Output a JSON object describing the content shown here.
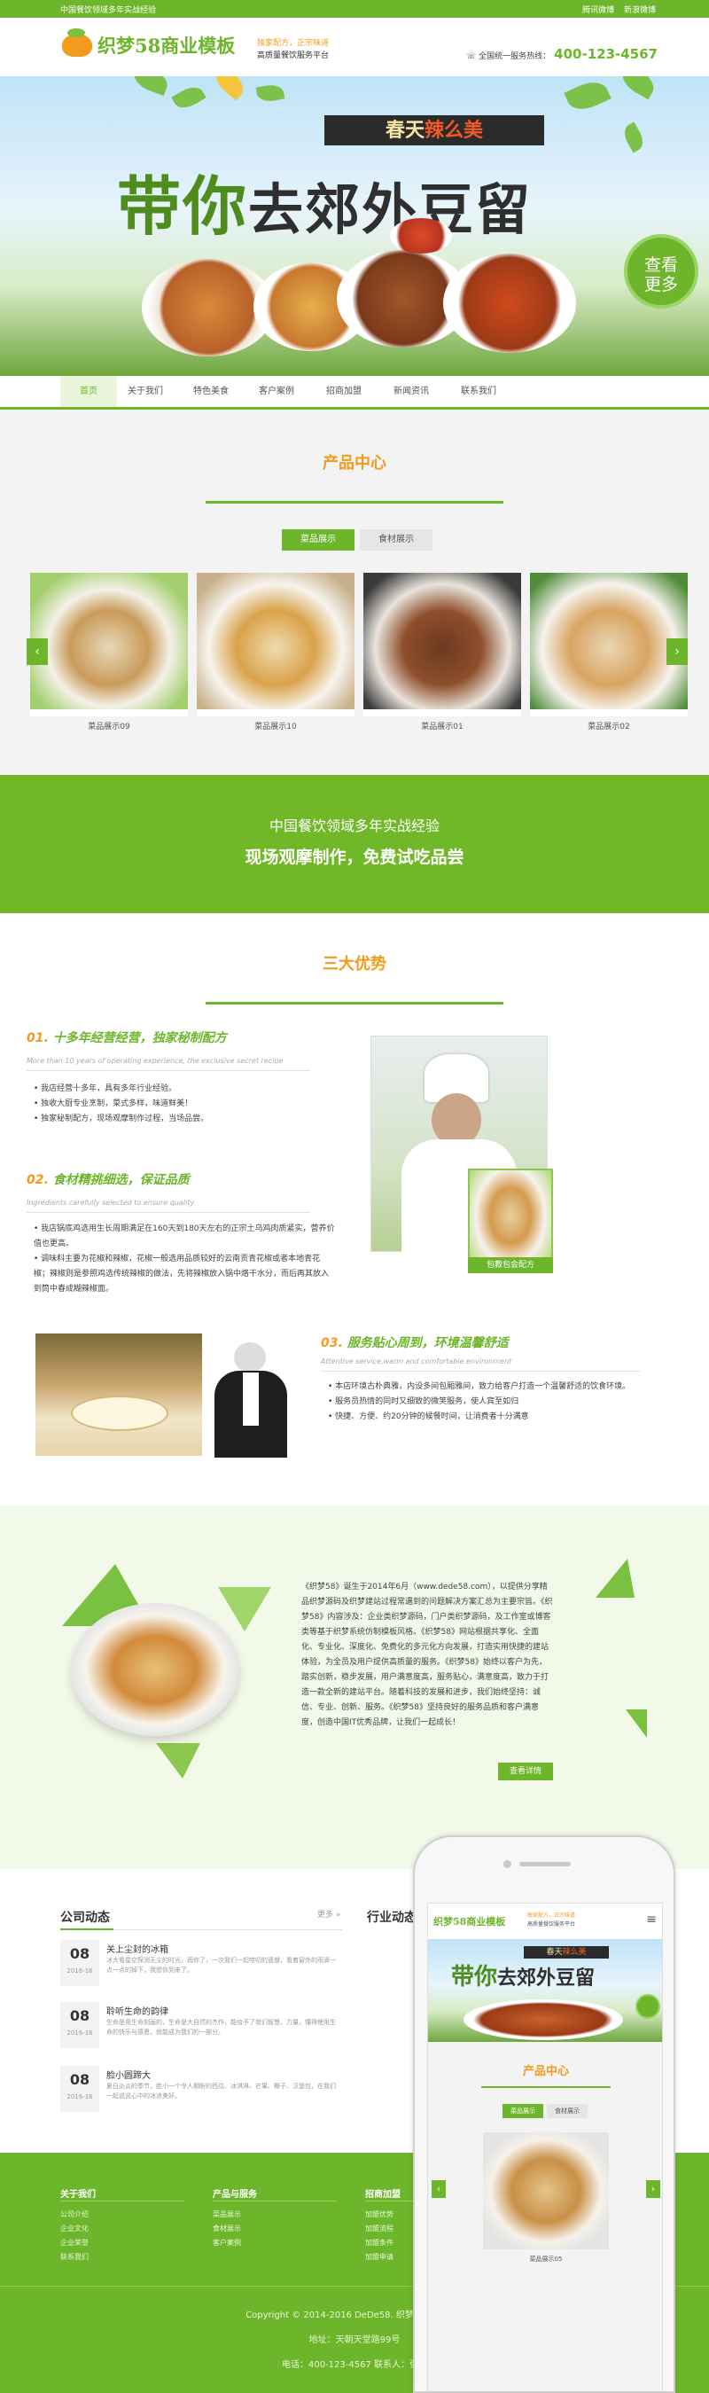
{
  "topbar": {
    "left": "中国餐饮领域多年实战经验",
    "links": [
      "腾讯微博",
      "新浪微博"
    ]
  },
  "header": {
    "logo": "织梦58商业模板",
    "slogan1": "独家配方，正宗味道",
    "slogan2": "高质量餐饮服务平台",
    "hotline_label": "全国统一服务热线：",
    "hotline_number": "400-123-4567"
  },
  "banner": {
    "ribbon_a": "春天",
    "ribbon_b": "辣么美",
    "title_a": "带你",
    "title_b": "去郊外豆留",
    "view_more": "查看更多"
  },
  "nav": [
    "首页",
    "关于我们",
    "特色美食",
    "客户案例",
    "招商加盟",
    "新闻资讯",
    "联系我们"
  ],
  "products": {
    "title": "产品中心",
    "tabs": [
      "菜品展示",
      "食材展示"
    ],
    "items": [
      "菜品展示09",
      "菜品展示10",
      "菜品展示01",
      "菜品展示02"
    ]
  },
  "band": {
    "line1": "中国餐饮领域多年实战经验",
    "line2": "现场观摩制作，免费试吃品尝"
  },
  "advantages": {
    "title": "三大优势",
    "a1": {
      "num": "01.",
      "title": "十多年经营经营，独家秘制配方",
      "sub": "More than 10 years of operating experience, the exclusive secret recipe",
      "list": [
        "我店经营十多年，具有多年行业经验。",
        "独收大厨专业烹制，菜式多样，味道鲜美！",
        "独家秘制配方，现场观摩制作过程，当场品尝。"
      ]
    },
    "a2": {
      "num": "02.",
      "title": "食材精挑细选，保证品质",
      "sub": "Ingredients carefully selected to ensure quality",
      "list": [
        "我店锅底鸡选用生长周期满足在160天到180天左右的正宗土乌鸡肉质紧实，营养价值也更高。",
        "调味料主要为花椒和辣椒，花椒一般选用品质较好的云南贡青花椒或者本地青花椒；辣椒则是参照鸡选传统辣椒的做法，先将辣椒放入锅中烙干水分，而后再其放入到筒中春成糊辣椒面。"
      ]
    },
    "a3": {
      "num": "03.",
      "title": "服务贴心周到，环境温馨舒适",
      "sub": "Attentive service,warm and comfortable environment",
      "list": [
        "本店环境古朴典雅，内设多间包厢雅间，致力给客户打造一个温馨舒适的饮食环境。",
        "服务员热情的同时又细致的微笑服务，使人宾至如归",
        "快捷、方便、约20分钟的候餐时间，让消费者十分满意"
      ]
    },
    "tag": "包教包会配方"
  },
  "about": {
    "text": "《织梦58》诞生于2014年6月（www.dede58.com），以提供分享精品织梦源码及织梦建站过程常遇到的问题解决方案汇总为主要宗旨。《织梦58》内容涉及：企业类织梦源码，门户类织梦源码，及工作室或博客类等基于织梦系统仿制模板风格。《织梦58》网站根据共享化、全面化、专业化、深度化、免费化的多元化方向发展，打造实用快捷的建站体验，为全员及用户提供高质量的服务。《织梦58》始终以客户为先，踏实创新，稳步发展，用户满意度高，服务贴心，满意度高，致力于打造一款全新的建站平台。随着科技的发展和进步，我们始终坚持：诚信、专业、创新、服务。《织梦58》坚持良好的服务品质和客户满意度，创造中国IT优秀品牌，让我们一起成长！",
    "button": "查看详情"
  },
  "news": {
    "title1": "公司动态",
    "more": "更多 »",
    "title2": "行业动态",
    "items": [
      {
        "day": "08",
        "year": "2016-16",
        "title": "关上尘封的冰箱",
        "desc": "冰大看星空探测无尘的时光，而你了，一次我们一起唠叨的遗憾，看着窗外的雨滴一点一点的掉下，我想你到来了。"
      },
      {
        "day": "08",
        "year": "2016-16",
        "title": "聆听生命的韵律",
        "desc": "生命是用生命刻画的，生命是大自然的杰作，能给予了我们智慧、力量，懂得使用生命的快乐与感恩，就能成为我们的一部分。"
      },
      {
        "day": "08",
        "year": "2016-16",
        "title": "脸小圆蹄大",
        "desc": "夏日炎炎的季节，脸小一个令人期盼的西瓜、冰淇淋、芒果、椰子、汉堡包，在我们一起说说心中的冰凉美好。"
      }
    ]
  },
  "footer": {
    "cols": [
      {
        "title": "关于我们",
        "links": [
          "公司介绍",
          "企业文化",
          "企业荣誉",
          "联系我们"
        ]
      },
      {
        "title": "产品与服务",
        "links": [
          "菜品展示",
          "食材展示",
          "客户案例"
        ]
      },
      {
        "title": "招商加盟",
        "links": [
          "加盟优势",
          "加盟流程",
          "加盟条件",
          "加盟申请"
        ]
      }
    ],
    "copyright": "Copyright © 2014-2016 DeDe58. 织梦58 版权所有",
    "address": "地址：天朝天堂路99号",
    "phone": "电话：400-123-4567 联系人：张生"
  },
  "mobile": {
    "logo": "织梦58商业模板",
    "slogan1": "独家配方，正宗味道",
    "slogan2": "高质量餐饮服务平台",
    "title": "产品中心",
    "tabs": [
      "菜品展示",
      "食材展示"
    ],
    "item": "菜品展示05"
  }
}
